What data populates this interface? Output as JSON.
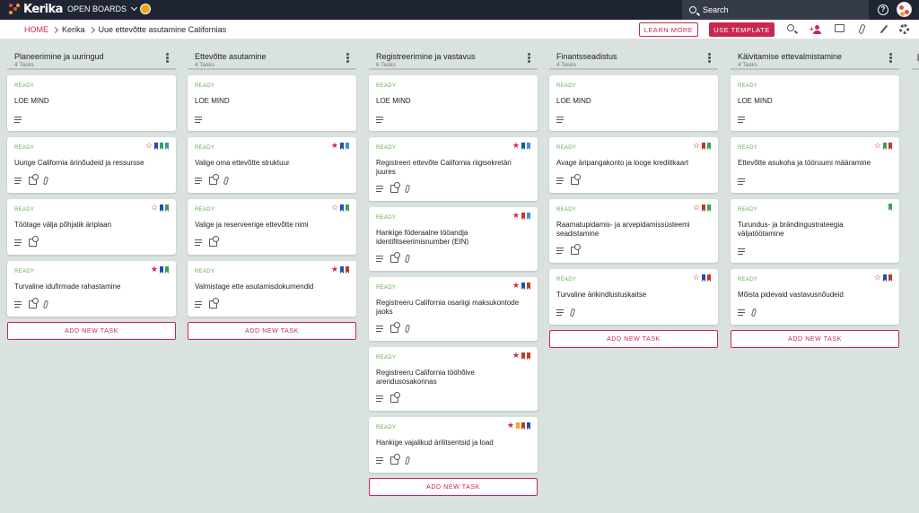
{
  "app": {
    "logo_text": "Kerika",
    "open_boards": "OPEN BOARDS"
  },
  "search": {
    "label": "Search"
  },
  "breadcrumb": {
    "home": "HOME",
    "org": "Kerika",
    "board": "Uue ettevõtte asutamine Californias"
  },
  "actions": {
    "learn_more": "LEARN MORE",
    "use_template": "USE TEMPLATE"
  },
  "colors": {
    "accent": "#c8284f",
    "topbar": "#1f2533",
    "ready": "#6aa84f",
    "star": "#d8263b",
    "blue_flag": "#1e4fb5",
    "green_flag": "#3aa15a",
    "teal_flag": "#2f9db0",
    "red_flag": "#c0392b",
    "orange_flag": "#f5a623",
    "lightblue_flag": "#3d8fe0"
  },
  "add_task_label": "ADD NEW TASK",
  "columns": [
    {
      "title": "Planeerimine ja uuringud",
      "count": "4 Tasks",
      "cards": [
        {
          "status": "READY",
          "title": "LOE MIND",
          "star": "none",
          "flags": [],
          "icons": [
            "desc"
          ]
        },
        {
          "status": "READY",
          "title": "Uurige California ärinõudeid ja ressursse",
          "star": "outline",
          "flags": [
            "#1e4fb5",
            "#3aa15a",
            "#2f9db0"
          ],
          "icons": [
            "desc",
            "check",
            "clip"
          ]
        },
        {
          "status": "READY",
          "title": "Töötage välja põhjalik äriplaan",
          "star": "outline",
          "flags": [
            "#1e4fb5",
            "#3aa15a"
          ],
          "icons": [
            "desc",
            "check"
          ]
        },
        {
          "status": "READY",
          "title": "Turvaline idufirmade rahastamine",
          "star": "filled",
          "flags": [
            "#1e4fb5",
            "#3aa15a"
          ],
          "icons": [
            "desc",
            "check",
            "clip"
          ]
        }
      ]
    },
    {
      "title": "Ettevõtte asutamine",
      "count": "4 Tasks",
      "cards": [
        {
          "status": "READY",
          "title": "LOE MIND",
          "star": "none",
          "flags": [],
          "icons": [
            "desc"
          ]
        },
        {
          "status": "READY",
          "title": "Valige oma ettevõtte struktuur",
          "star": "filled",
          "flags": [
            "#1e4fb5",
            "#2f9db0"
          ],
          "icons": [
            "desc",
            "check",
            "clip"
          ]
        },
        {
          "status": "READY",
          "title": "Valige ja reserveerige ettevõtte nimi",
          "star": "outline",
          "flags": [
            "#1e4fb5",
            "#3aa15a"
          ],
          "icons": [
            "desc",
            "check"
          ]
        },
        {
          "status": "READY",
          "title": "Valmistage ette asutamisdokumendid",
          "star": "filled",
          "flags": [
            "#1e4fb5",
            "#c0392b"
          ],
          "icons": [
            "desc",
            "check"
          ]
        }
      ]
    },
    {
      "title": "Registreerimine ja vastavus",
      "count": "6 Tasks",
      "cards": [
        {
          "status": "READY",
          "title": "LOE MIND",
          "star": "none",
          "flags": [],
          "icons": [
            "desc"
          ]
        },
        {
          "status": "READY",
          "title": "Registreeri ettevõte California riigisekretäri juures",
          "star": "filled",
          "flags": [
            "#1e4fb5",
            "#3d8fe0"
          ],
          "icons": [
            "desc",
            "check",
            "clip"
          ]
        },
        {
          "status": "READY",
          "title": "Hankige föderaalne tööandja identifitseerimisnumber (EIN)",
          "star": "filled",
          "flags": [
            "#c0392b",
            "#3d8fe0"
          ],
          "icons": [
            "desc",
            "check",
            "clip"
          ]
        },
        {
          "status": "READY",
          "title": "Registreeru California osariigi maksukontode jaoks",
          "star": "filled",
          "flags": [
            "#1e4fb5",
            "#c0392b"
          ],
          "icons": [
            "desc",
            "check",
            "clip"
          ]
        },
        {
          "status": "READY",
          "title": "Registreeru California tööhõive arendusosakonnas",
          "star": "filled",
          "flags": [
            "#c0392b",
            "#c0392b"
          ],
          "icons": [
            "desc",
            "check"
          ]
        },
        {
          "status": "READY",
          "title": "Hankige vajalikud ärilitsentsid ja load",
          "star": "filled",
          "flags": [
            "#f5a623",
            "#c0392b",
            "#1e4fb5"
          ],
          "icons": [
            "desc",
            "check",
            "clip"
          ]
        }
      ]
    },
    {
      "title": "Finantsseadistus",
      "count": "4 Tasks",
      "cards": [
        {
          "status": "READY",
          "title": "LOE MIND",
          "star": "none",
          "flags": [],
          "icons": [
            "desc"
          ]
        },
        {
          "status": "READY",
          "title": "Avage äripangakonto ja looge krediitkaart",
          "star": "outline",
          "flags": [
            "#c0392b",
            "#3aa15a"
          ],
          "icons": [
            "desc",
            "check"
          ]
        },
        {
          "status": "READY",
          "title": "Raamatupidamis- ja arvepidamissüsteemi seadistamine",
          "star": "outline",
          "flags": [
            "#c0392b",
            "#3aa15a"
          ],
          "icons": [
            "desc",
            "check"
          ]
        },
        {
          "status": "READY",
          "title": "Turvaline ärikindlustuskaitse",
          "star": "outline",
          "flags": [
            "#1e4fb5",
            "#c0392b"
          ],
          "icons": [
            "desc",
            "clip"
          ]
        }
      ]
    },
    {
      "title": "Käivitamise ettevalmistamine",
      "count": "4 Tasks",
      "cards": [
        {
          "status": "READY",
          "title": "LOE MIND",
          "star": "none",
          "flags": [],
          "icons": [
            "desc"
          ]
        },
        {
          "status": "READY",
          "title": "Ettevõtte asukoha ja tööruumi määramine",
          "star": "outline",
          "flags": [
            "#3aa15a",
            "#c0392b"
          ],
          "icons": [
            "desc"
          ]
        },
        {
          "status": "READY",
          "title": "Turundus- ja brändingustrateegia väljatöötamine",
          "star": "none",
          "flags": [
            "#3aa15a"
          ],
          "icons": [
            "desc"
          ]
        },
        {
          "status": "READY",
          "title": "Mõista pidevaid vastavusnõudeid",
          "star": "outline",
          "flags": [
            "#1e4fb5",
            "#c0392b"
          ],
          "icons": [
            "desc",
            "clip"
          ]
        }
      ]
    }
  ]
}
